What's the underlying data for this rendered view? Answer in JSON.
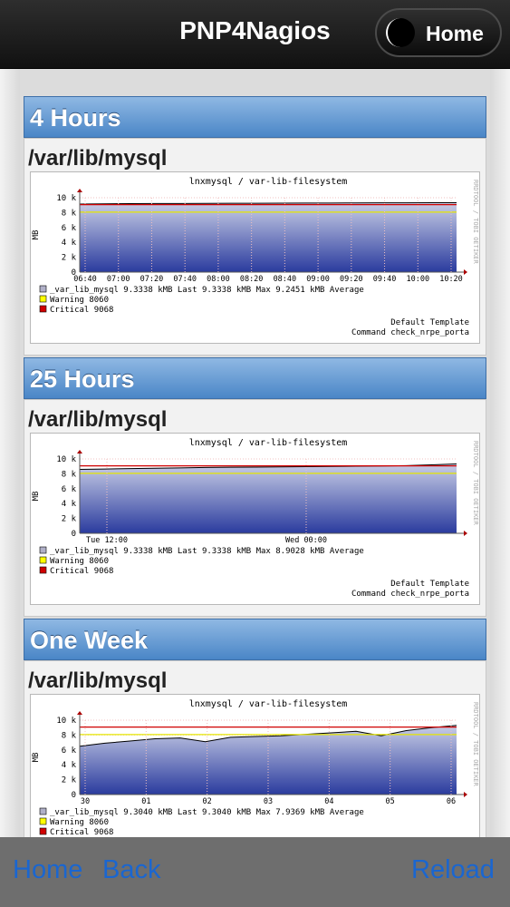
{
  "header": {
    "title": "PNP4Nagios",
    "home_label": "Home"
  },
  "sections": [
    {
      "heading": "4 Hours",
      "subtitle": "/var/lib/mysql",
      "graph": {
        "title": "lnxmysql / var-lib-filesystem",
        "ylabel": "MB",
        "yticks": [
          "10 k",
          "8 k",
          "6 k",
          "4 k",
          "2 k",
          "0"
        ],
        "xticks": [
          "06:40",
          "07:00",
          "07:20",
          "07:40",
          "08:00",
          "08:20",
          "08:40",
          "09:00",
          "09:20",
          "09:40",
          "10:00",
          "10:20"
        ],
        "side_label": "RRDTOOL / TOBI OETIKER",
        "legend": [
          {
            "name": "_var_lib_mysql",
            "stats": "9.3338 kMB Last    9.3338 kMB Max    9.2451 kMB Average",
            "color": "#b0b0c8"
          },
          {
            "name": "Warning",
            "stats": "8060",
            "color": "#ffff00"
          },
          {
            "name": "Critical",
            "stats": "9068",
            "color": "#d00000"
          }
        ],
        "footer1": "Default Template",
        "footer2": "Command check_nrpe_porta"
      }
    },
    {
      "heading": "25 Hours",
      "subtitle": "/var/lib/mysql",
      "graph": {
        "title": "lnxmysql / var-lib-filesystem",
        "ylabel": "MB",
        "yticks": [
          "10 k",
          "8 k",
          "6 k",
          "4 k",
          "2 k",
          "0"
        ],
        "xticks": [
          "Tue 12:00",
          "Wed 00:00"
        ],
        "side_label": "RRDTOOL / TOBI OETIKER",
        "legend": [
          {
            "name": "_var_lib_mysql",
            "stats": "9.3338 kMB Last    9.3338 kMB Max    8.9028 kMB Average",
            "color": "#b0b0c8"
          },
          {
            "name": "Warning",
            "stats": "8060",
            "color": "#ffff00"
          },
          {
            "name": "Critical",
            "stats": "9068",
            "color": "#d00000"
          }
        ],
        "footer1": "Default Template",
        "footer2": "Command check_nrpe_porta"
      }
    },
    {
      "heading": "One Week",
      "subtitle": "/var/lib/mysql",
      "graph": {
        "title": "lnxmysql / var-lib-filesystem",
        "ylabel": "MB",
        "yticks": [
          "10 k",
          "8 k",
          "6 k",
          "4 k",
          "2 k",
          "0"
        ],
        "xticks": [
          "30",
          "01",
          "02",
          "03",
          "04",
          "05",
          "06"
        ],
        "side_label": "RRDTOOL / TOBI OETIKER",
        "legend": [
          {
            "name": "_var_lib_mysql",
            "stats": "9.3040 kMB Last    9.3040 kMB Max    7.9369 kMB Average",
            "color": "#b0b0c8"
          },
          {
            "name": "Warning",
            "stats": "8060",
            "color": "#ffff00"
          },
          {
            "name": "Critical",
            "stats": "9068",
            "color": "#d00000"
          }
        ],
        "footer1": "",
        "footer2": ""
      }
    }
  ],
  "chart_series": [
    {
      "warning": 8060,
      "critical": 9068,
      "values": [
        9150,
        9180,
        9200,
        9220,
        9230,
        9240,
        9250,
        9260,
        9270,
        9280,
        9290,
        9300,
        9310,
        9320,
        9330,
        9334
      ]
    },
    {
      "warning": 8060,
      "critical": 9068,
      "values": [
        8600,
        8650,
        8700,
        8750,
        8800,
        8850,
        8880,
        8900,
        8930,
        8960,
        8990,
        9020,
        9060,
        9100,
        9200,
        9334
      ]
    },
    {
      "warning": 8060,
      "critical": 9068,
      "values": [
        6500,
        6900,
        7200,
        7500,
        7600,
        7100,
        7700,
        7800,
        7900,
        8100,
        8300,
        8500,
        7900,
        8600,
        9000,
        9304
      ]
    }
  ],
  "bottombar": {
    "home_label": "Home",
    "back_label": "Back",
    "reload_label": "Reload"
  }
}
